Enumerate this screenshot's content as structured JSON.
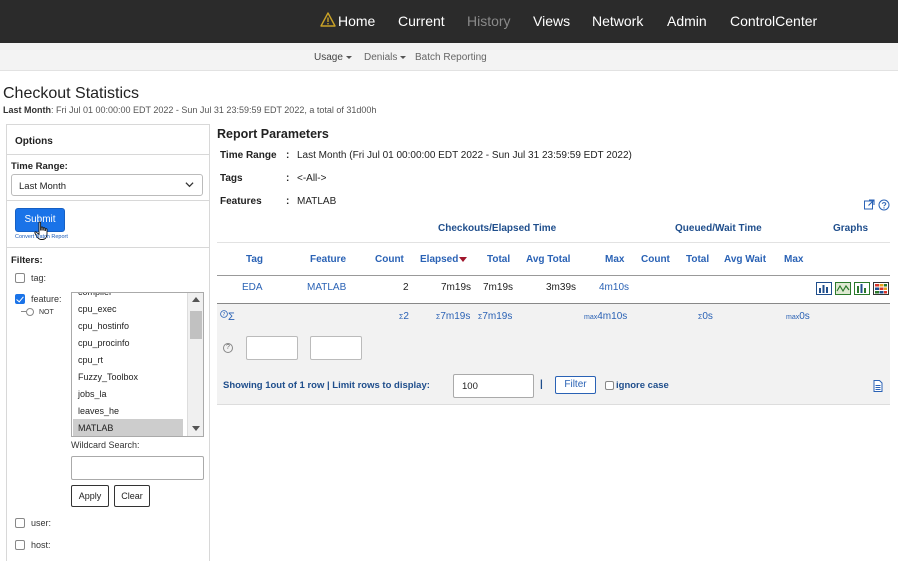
{
  "topnav": {
    "items": [
      {
        "label": "Home",
        "disabled": false
      },
      {
        "label": "Current",
        "disabled": false
      },
      {
        "label": "History",
        "disabled": true
      },
      {
        "label": "Views",
        "disabled": false
      },
      {
        "label": "Network",
        "disabled": false
      },
      {
        "label": "Admin",
        "disabled": false
      },
      {
        "label": "ControlCenter",
        "disabled": false
      }
    ],
    "warning_color": "#c9a227"
  },
  "subnav": {
    "items": [
      {
        "label": "Usage",
        "dropdown": true
      },
      {
        "label": "Denials",
        "dropdown": true
      },
      {
        "label": "Batch Reporting",
        "dropdown": false
      }
    ]
  },
  "page": {
    "title": "Checkout Statistics",
    "period_label": "Last Month",
    "period_detail": ": Fri Jul 01 00:00:00 EDT 2022 - Sun Jul 31 23:59:59 EDT 2022, a total of 31d00h"
  },
  "options": {
    "heading": "Options",
    "time_range_label": "Time Range:",
    "time_range_value": "Last Month",
    "submit_label": "Submit",
    "tiny_links": "Convert  Batch Report",
    "filters_label": "Filters:",
    "filters": {
      "tag": {
        "label": "tag:",
        "checked": false
      },
      "feature": {
        "label": "feature:",
        "checked": true,
        "not_label": "NOT"
      },
      "user": {
        "label": "user:",
        "checked": false
      },
      "host": {
        "label": "host:",
        "checked": false
      }
    },
    "feature_list": [
      "compiler",
      "cpu_exec",
      "cpu_hostinfo",
      "cpu_procinfo",
      "cpu_rt",
      "Fuzzy_Toolbox",
      "jobs_la",
      "leaves_he",
      "MATLAB"
    ],
    "feature_selected": "MATLAB",
    "wildcard_label": "Wildcard Search:",
    "wildcard_value": "",
    "apply_label": "Apply",
    "clear_label": "Clear"
  },
  "report": {
    "title": "Report Parameters",
    "params": [
      {
        "key": "Time Range",
        "value": "Last Month (Fri Jul 01 00:00:00 EDT 2022 - Sun Jul 31 23:59:59 EDT 2022)"
      },
      {
        "key": "Tags",
        "value": "<-All->"
      },
      {
        "key": "Features",
        "value": "MATLAB"
      }
    ]
  },
  "table": {
    "groups": {
      "checkouts": "Checkouts/Elapsed Time",
      "queued": "Queued/Wait Time",
      "graphs": "Graphs"
    },
    "columns": {
      "tag": "Tag",
      "feature": "Feature",
      "count": "Count",
      "elapsed": "Elapsed",
      "total": "Total",
      "avg_total": "Avg Total",
      "max": "Max",
      "q_count": "Count",
      "q_total": "Total",
      "avg_wait": "Avg Wait",
      "q_max": "Max"
    },
    "rows": [
      {
        "tag": "EDA",
        "feature": "MATLAB",
        "count": "2",
        "elapsed": "7m19s",
        "total": "7m19s",
        "avg_total": "3m39s",
        "max": "4m10s"
      }
    ],
    "totals": {
      "sigma": "Σ",
      "count": "2",
      "elapsed": "7m19s",
      "total": "7m19s",
      "max": "4m10s",
      "q_total": "0s",
      "q_max": "0s",
      "sum_prefix": "Σ",
      "max_prefix": "max"
    },
    "footer": {
      "showing": "Showing 1out of 1 row  |  Limit rows to display:",
      "limit_value": "100",
      "pipe": "|",
      "filter_label": "Filter",
      "ignore_case_label": "ignore case"
    }
  }
}
